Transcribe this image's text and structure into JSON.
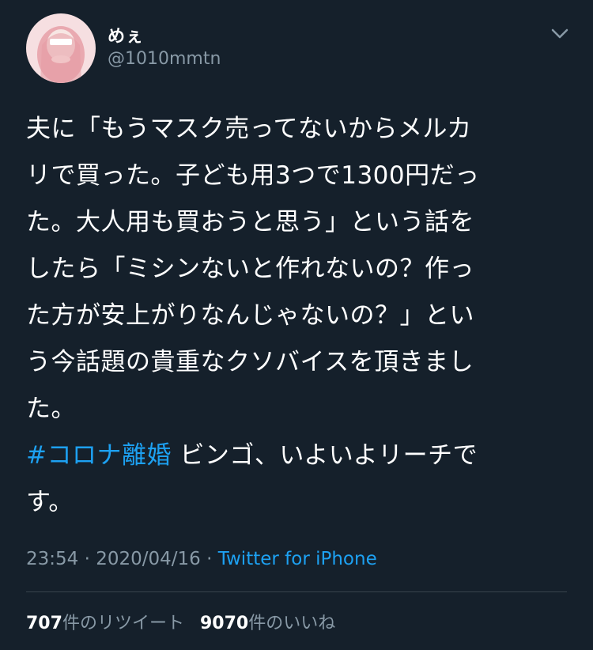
{
  "user": {
    "display_name": "めぇ",
    "handle": "@1010mmtn"
  },
  "tweet": {
    "lines": [
      "夫に「もうマスク売ってないからメルカ",
      "リで買った。子ども用3つで1300円だっ",
      "た。大人用も買おうと思う」という話を",
      "したら「ミシンないと作れないの？作っ",
      "た方が安上がりなんじゃないの？」とい",
      "う今話題の貴重なクソバイスを頂きまし",
      "た。"
    ],
    "hashtag": "#コロナ離婚",
    "after_hashtag": " ビンゴ、いよいよリーチで",
    "last_line": "す。"
  },
  "meta": {
    "time": "23:54",
    "separator1": " · ",
    "date": "2020/04/16",
    "separator2": " · ",
    "source": "Twitter for iPhone"
  },
  "stats": {
    "retweets_count": "707",
    "retweets_label": "件のリツイート",
    "likes_count": "9070",
    "likes_label": "件のいいね"
  },
  "colors": {
    "background": "#15202b",
    "link": "#1da1f2",
    "secondary_text": "#8899a6"
  }
}
